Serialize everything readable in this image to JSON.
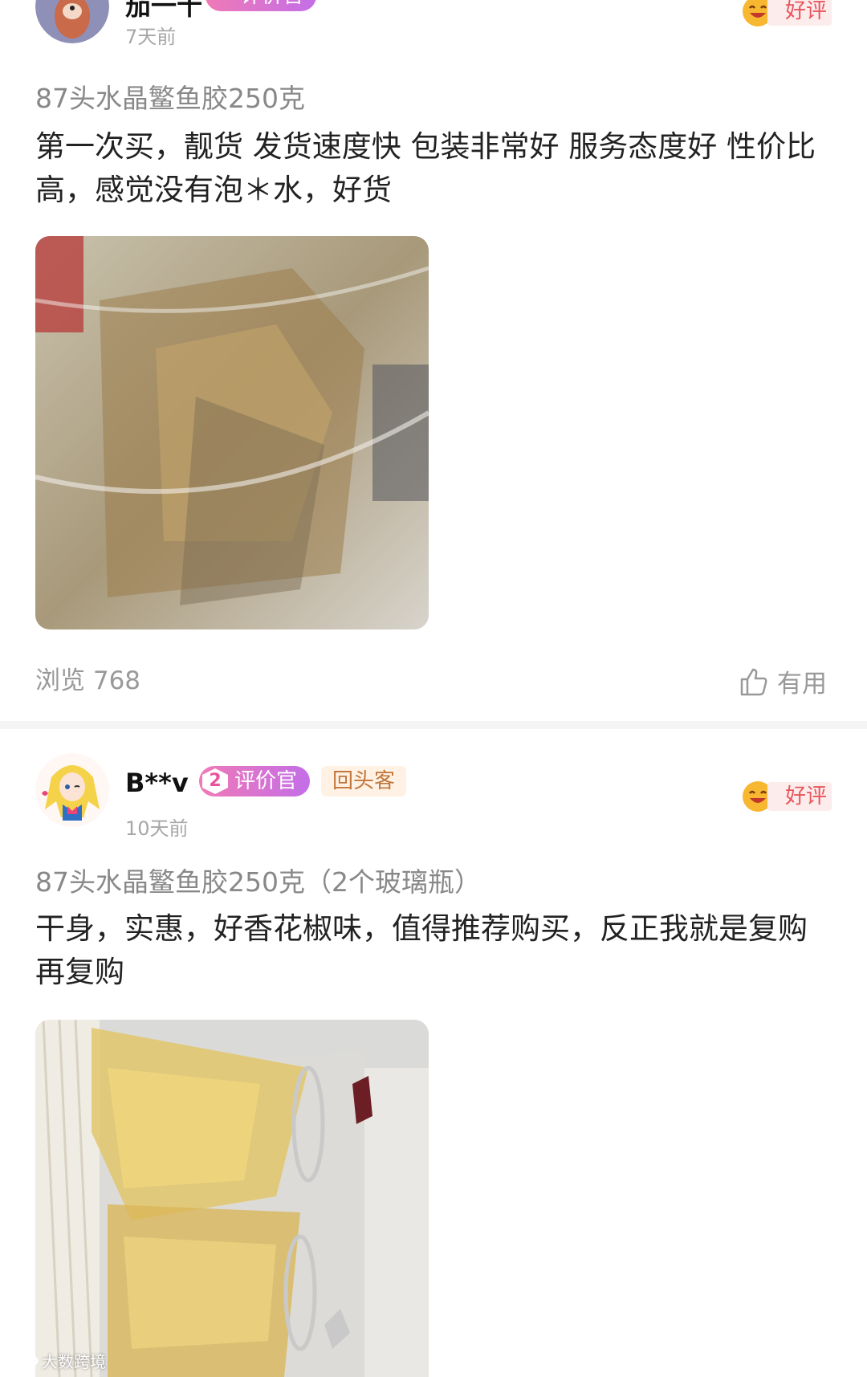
{
  "reviews": [
    {
      "username": "茄一十",
      "official_badge": "评价官",
      "official_level": "",
      "returning_badge": "",
      "time": "7天前",
      "rating_label": "好评",
      "spec": "87头水晶鳘鱼胶250克",
      "content": "第一次买，靓货 发货速度快 包装非常好 服务态度好 性价比高，感觉没有泡＊水，好货",
      "views": "浏览 768",
      "useful_label": "有用"
    },
    {
      "username": "B**v",
      "official_badge": "评价官",
      "official_level": "2",
      "returning_badge": "回头客",
      "time": "10天前",
      "rating_label": "好评",
      "spec": "87头水晶鳘鱼胶250克（2个玻璃瓶）",
      "content": "干身，实惠，好香花椒味，值得推荐购买，反正我就是复购再复购"
    }
  ],
  "watermark": "大数跨境",
  "colors": {
    "good_rating": "#e8555c",
    "official_badge_from": "#f07ab6",
    "official_badge_to": "#c36ee8",
    "returning_badge_text": "#c2763a"
  }
}
